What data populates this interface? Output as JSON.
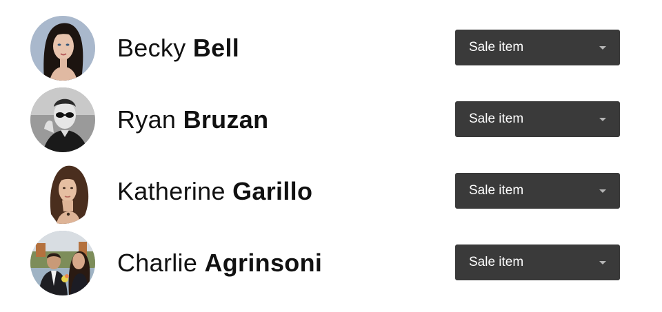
{
  "people": [
    {
      "first_name": "Becky",
      "last_name": "Bell",
      "select": {
        "value": "Sale item"
      }
    },
    {
      "first_name": "Ryan",
      "last_name": "Bruzan",
      "select": {
        "value": "Sale item"
      }
    },
    {
      "first_name": "Katherine",
      "last_name": "Garillo",
      "select": {
        "value": "Sale item"
      }
    },
    {
      "first_name": "Charlie",
      "last_name": "Agrinsoni",
      "select": {
        "value": "Sale item"
      }
    }
  ],
  "colors": {
    "select_background": "#3a3a3a",
    "select_text": "#ffffff",
    "caret": "#b5b5b5",
    "name_text": "#111111"
  },
  "icons": {
    "dropdown": "caret-down-icon"
  }
}
